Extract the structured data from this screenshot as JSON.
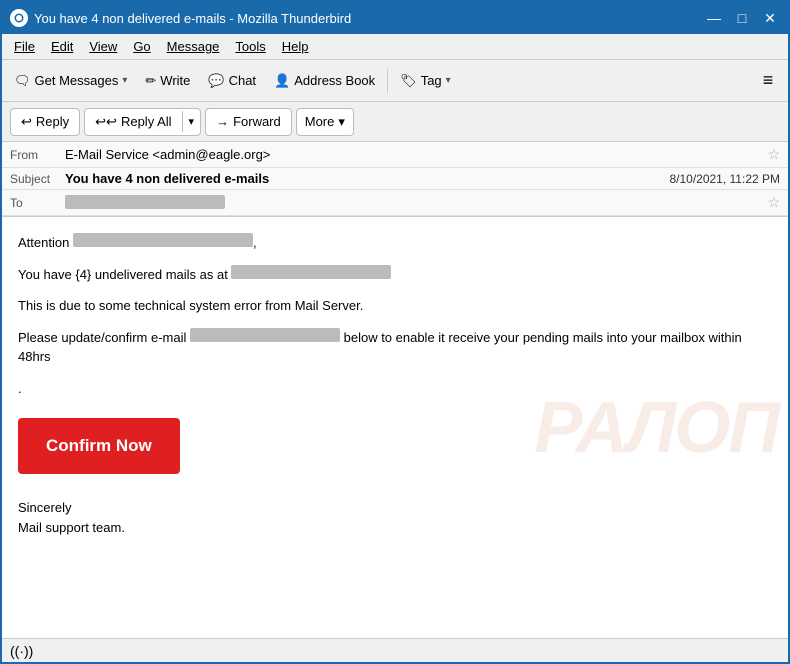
{
  "window": {
    "title": "You have 4 non delivered e-mails - Mozilla Thunderbird",
    "minimize_label": "—",
    "maximize_label": "□",
    "close_label": "✕"
  },
  "menubar": {
    "items": [
      "File",
      "Edit",
      "View",
      "Go",
      "Message",
      "Tools",
      "Help"
    ]
  },
  "toolbar": {
    "get_messages_label": "Get Messages",
    "write_label": "Write",
    "chat_label": "Chat",
    "address_book_label": "Address Book",
    "tag_label": "Tag",
    "menu_icon": "≡"
  },
  "reply_toolbar": {
    "reply_label": "Reply",
    "reply_all_label": "Reply All",
    "forward_label": "Forward",
    "more_label": "More"
  },
  "email": {
    "from_label": "From",
    "from_value": "E-Mail Service <admin@eagle.org>",
    "subject_label": "Subject",
    "subject_value": "You have 4 non delivered e-mails",
    "date_value": "8/10/2021, 11:22 PM",
    "to_label": "To",
    "to_value": "████████████████",
    "body_attention": "Attention",
    "body_recipient_blur": "██████████████████,",
    "body_line2_pre": "You have {4} undelivered mails as at",
    "body_line2_blur": "████████████████████",
    "body_line3": "This is due to some technical system error from Mail Server.",
    "body_line4_pre": "Please update/confirm e-mail",
    "body_line4_blur": "████████████████████",
    "body_line4_post": "below to enable it receive your pending mails into your mailbox within 48hrs",
    "body_dot": ".",
    "confirm_button_label": "Confirm Now",
    "body_sign1": "Sincerely",
    "body_sign2": "Mail support team.",
    "watermark": "РАЛОП"
  },
  "statusbar": {
    "wifi_icon": "((·))"
  }
}
